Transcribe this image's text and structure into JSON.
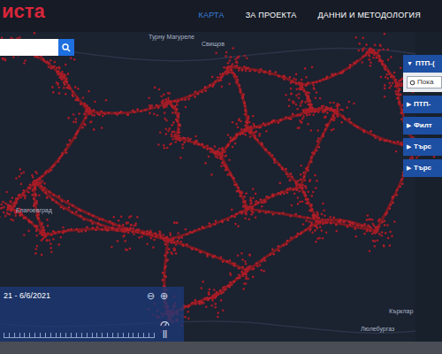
{
  "logo": "иста",
  "nav": [
    {
      "label": "КАРТА",
      "selected": true
    },
    {
      "label": "ЗА ПРОЕКТА",
      "selected": false
    },
    {
      "label": "ДАННИ И МЕТОДОЛОГИЯ",
      "selected": false
    }
  ],
  "panel": {
    "sections": [
      {
        "icon": "▼",
        "label": "ПТП-(",
        "expanded": true
      },
      {
        "icon": "▶",
        "label": "ПТП-",
        "expanded": false
      },
      {
        "icon": "▶",
        "label": "Филт",
        "expanded": false
      },
      {
        "icon": "▶",
        "label": "Търс",
        "expanded": false
      },
      {
        "icon": "▶",
        "label": "Търс",
        "expanded": false
      }
    ],
    "field": "Пока"
  },
  "map_labels": [
    "Турну Магуреле",
    "Свищов",
    "Благоевград",
    "Люлебургаз",
    "Кърклар"
  ],
  "timeline": {
    "range": "21 - 6/6/2021",
    "zoom_out": "⊖",
    "zoom_in": "⊕",
    "pause": "||"
  }
}
